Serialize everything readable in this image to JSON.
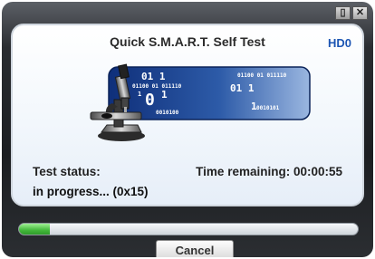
{
  "window": {
    "controls": [
      "restore",
      "close"
    ],
    "restore_glyph": "▯",
    "close_glyph": "✕"
  },
  "dialog": {
    "title": "Quick S.M.A.R.T. Self Test",
    "drive": "HD0",
    "status_label": "Test status:",
    "status_value": "in progress... (0x15)",
    "time_remaining": "Time remaining: 00:00:55"
  },
  "illustration": {
    "icon": "microscope-icon",
    "binary": [
      "01 1",
      "01100 01 011110",
      "0",
      "1",
      "1",
      "0010100",
      "01100 01 011110",
      "01  1",
      "1",
      "0010101"
    ]
  },
  "progress": {
    "fraction": 0.09
  },
  "buttons": {
    "cancel_label": "Cancel"
  },
  "colors": {
    "accent": "#1c55b3",
    "progress_green": "#43b83b",
    "banner_blue": "#2d5ba8"
  }
}
